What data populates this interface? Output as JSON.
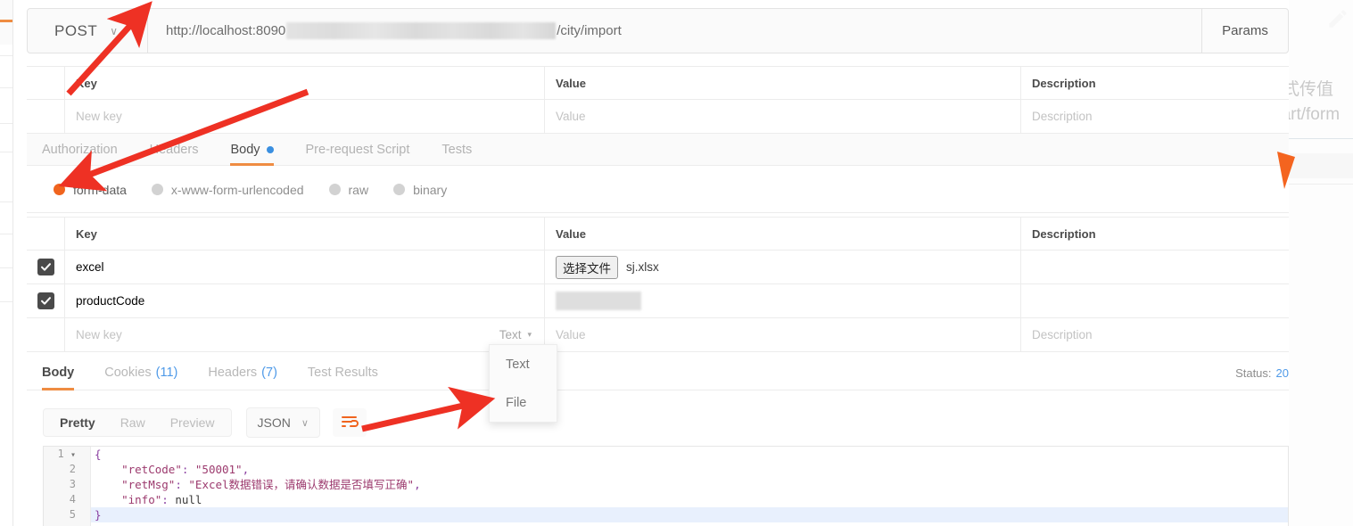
{
  "request": {
    "method": "POST",
    "method_caret": "∨",
    "url_prefix": "http://localhost:8090",
    "url_suffix": "/city/import",
    "params_button": "Params"
  },
  "params_table": {
    "headers": {
      "key": "Key",
      "value": "Value",
      "description": "Description"
    },
    "new_row": {
      "key": "New key",
      "value": "Value",
      "description": "Description"
    }
  },
  "request_tabs": [
    {
      "label": "Authorization",
      "active": false,
      "dot": false
    },
    {
      "label": "Headers",
      "active": false,
      "dot": false
    },
    {
      "label": "Body",
      "active": true,
      "dot": true
    },
    {
      "label": "Pre-request Script",
      "active": false,
      "dot": false
    },
    {
      "label": "Tests",
      "active": false,
      "dot": false
    }
  ],
  "body_types": [
    {
      "label": "form-data",
      "selected": true
    },
    {
      "label": "x-www-form-urlencoded",
      "selected": false
    },
    {
      "label": "raw",
      "selected": false
    },
    {
      "label": "binary",
      "selected": false
    }
  ],
  "form_table": {
    "headers": {
      "key": "Key",
      "value": "Value",
      "description": "Description"
    },
    "rows": [
      {
        "checked": true,
        "key": "excel",
        "value_type": "file",
        "file_button": "选择文件",
        "file_name": "sj.xlsx",
        "description": ""
      },
      {
        "checked": true,
        "key": "productCode",
        "value_type": "redacted",
        "file_button": "",
        "file_name": "",
        "description": ""
      }
    ],
    "new_row": {
      "key": "New key",
      "type": "Text",
      "type_caret": "▾",
      "value": "Value",
      "description": "Description"
    }
  },
  "type_menu": {
    "items": [
      {
        "label": "Text"
      },
      {
        "label": "File"
      }
    ]
  },
  "response_tabs": [
    {
      "label": "Body",
      "count": "",
      "active": true
    },
    {
      "label": "Cookies",
      "count": "(11)",
      "active": false
    },
    {
      "label": "Headers",
      "count": "(7)",
      "active": false
    },
    {
      "label": "Test Results",
      "count": "",
      "active": false
    }
  ],
  "status": {
    "label": "Status:",
    "value": "20"
  },
  "view_bar": {
    "modes": [
      {
        "label": "Pretty",
        "active": true
      },
      {
        "label": "Raw",
        "active": false
      },
      {
        "label": "Preview",
        "active": false
      }
    ],
    "format": "JSON",
    "format_caret": "∨",
    "wrap_icon": "wrap-lines-icon"
  },
  "code": {
    "lines": [
      {
        "num": "1",
        "fold": true,
        "text": "{"
      },
      {
        "num": "2",
        "fold": false,
        "text": "    \"retCode\": \"50001\","
      },
      {
        "num": "3",
        "fold": false,
        "text": "    \"retMsg\": \"Excel数据错误，请确认数据是否填写正确\","
      },
      {
        "num": "4",
        "fold": false,
        "text": "    \"info\": null"
      },
      {
        "num": "5",
        "fold": false,
        "text": "}"
      }
    ],
    "retCode_key": "\"retCode\"",
    "retCode_val": "\"50001\"",
    "retMsg_key": "\"retMsg\"",
    "retMsg_val": "\"Excel数据错误，请确认数据是否填写正确\"",
    "info_key": "\"info\"",
    "info_val": "null"
  },
  "background_window": {
    "text_cn": "式传值",
    "text_mime": "part/form"
  },
  "colors": {
    "accent_orange": "#ef8c42",
    "radio_on": "#f0641e",
    "blue_dot": "#3a8fe0",
    "link_blue": "#4f9ae8",
    "arrow_red": "#ee3124"
  },
  "annotations": {
    "arrow_1": "arrow-to-method-dropdown",
    "arrow_2": "arrow-to-form-data-radio",
    "arrow_3": "arrow-to-file-menu-item"
  }
}
